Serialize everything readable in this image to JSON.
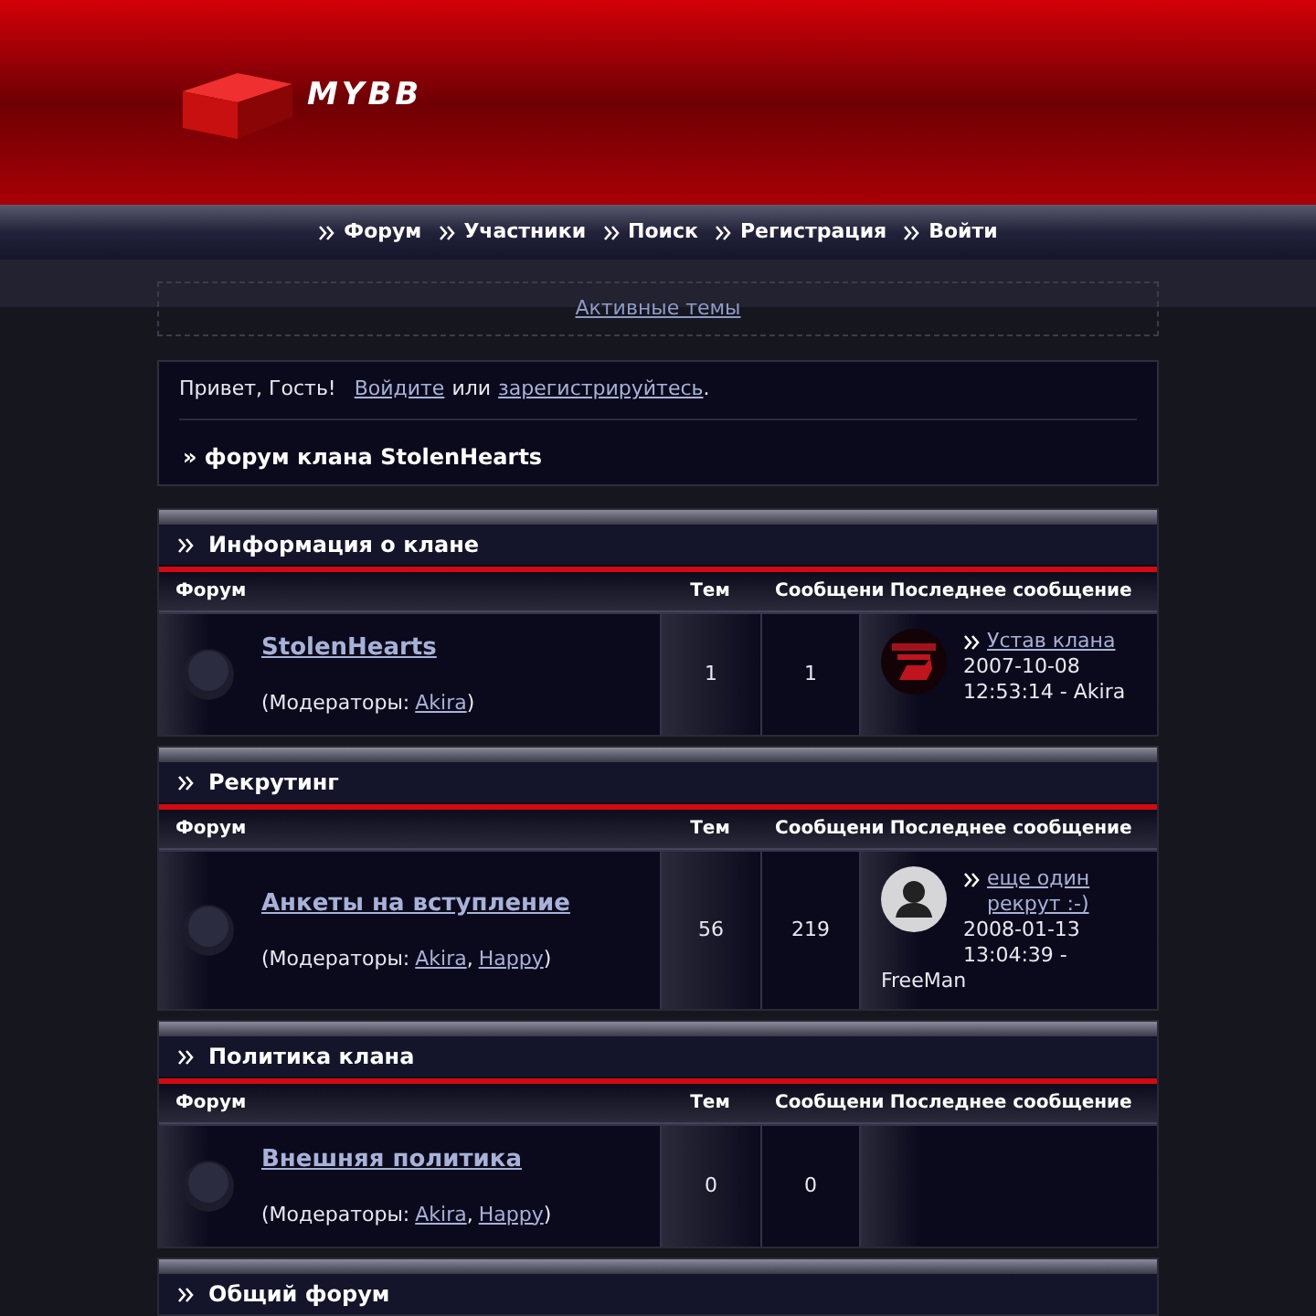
{
  "logo_text": "MYBB",
  "nav": [
    "Форум",
    "Участники",
    "Поиск",
    "Регистрация",
    "Войти"
  ],
  "active_topics": "Активные темы",
  "welcome": {
    "greeting": "Привет, Гость!",
    "login": "Войдите",
    "or": "или",
    "register": "зарегистрируйтесь",
    "end": ".",
    "forum_title": "» форум клана StolenHearts"
  },
  "sections": [
    {
      "title": "Информация о клане",
      "columns": [
        "Форум",
        "Тем",
        "Сообщени",
        "Последнее сообщение"
      ],
      "forums": [
        {
          "name": "StolenHearts",
          "moderators_label": "(Модераторы:",
          "moderators": [
            "Akira"
          ],
          "close": ")",
          "topics": "1",
          "posts": "1",
          "last_post": {
            "kind": "picture",
            "title": "Устав клана",
            "date": "2007-10-08",
            "time_author": "12:53:14 - Akira"
          }
        }
      ]
    },
    {
      "title": "Рекрутинг",
      "columns": [
        "Форум",
        "Тем",
        "Сообщени",
        "Последнее сообщение"
      ],
      "forums": [
        {
          "name": "Анкеты на вступление",
          "moderators_label": "(Модераторы:",
          "moderators": [
            "Akira",
            "Happy"
          ],
          "separators": [
            ","
          ],
          "close": ")",
          "topics": "56",
          "posts": "219",
          "last_post": {
            "kind": "silhouette",
            "title": "еще один рекрут :-)",
            "date": "2008-01-13",
            "time_author": "13:04:39 -",
            "author": "FreeMan"
          }
        }
      ]
    },
    {
      "title": "Политика клана",
      "columns": [
        "Форум",
        "Тем",
        "Сообщени",
        "Последнее сообщение"
      ],
      "forums": [
        {
          "name": "Внешняя политика",
          "moderators_label": "(Модераторы:",
          "moderators": [
            "Akira",
            "Happy"
          ],
          "separators": [
            ","
          ],
          "close": ")",
          "topics": "0",
          "posts": "0"
        }
      ]
    },
    {
      "title": "Общий форум"
    }
  ]
}
